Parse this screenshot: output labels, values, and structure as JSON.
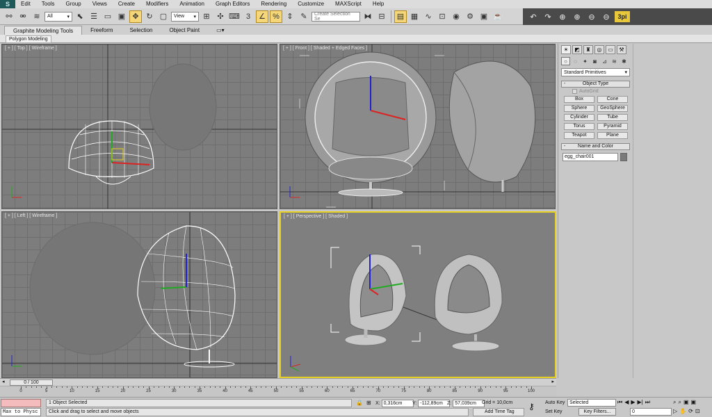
{
  "app": {
    "logo": "S"
  },
  "menu": [
    "Edit",
    "Tools",
    "Group",
    "Views",
    "Create",
    "Modifiers",
    "Animation",
    "Graph Editors",
    "Rendering",
    "Customize",
    "MAXScript",
    "Help"
  ],
  "toolbar": {
    "selection_filter": "All",
    "ref_coord": "View",
    "selection_set_placeholder": "Create Selection Se",
    "brand": "3pi"
  },
  "ribbon": {
    "tabs": [
      "Graphite Modeling Tools",
      "Freeform",
      "Selection",
      "Object Paint"
    ],
    "active_tab": 0,
    "sub_label": "Polygon Modeling"
  },
  "viewports": {
    "top": "[ + ] [ Top ] [ Wireframe ]",
    "front": "[ + ] [ Front ] [ Shaded + Edged Faces ]",
    "left": "[ + ] [ Left ] [ Wireframe ]",
    "perspective": "[ + ] [ Perspective ] [ Shaded ]"
  },
  "command_panel": {
    "dropdown": "Standard Primitives",
    "object_type_title": "Object Type",
    "autogrid": "AutoGrid",
    "primitives": [
      "Box",
      "Cone",
      "Sphere",
      "GeoSphere",
      "Cylinder",
      "Tube",
      "Torus",
      "Pyramid",
      "Teapot",
      "Plane"
    ],
    "name_color_title": "Name and Color",
    "object_name": "egg_chair001",
    "object_color": "#7a7a7a"
  },
  "timeline": {
    "frame_label": "0 / 100",
    "ticks": [
      0,
      5,
      10,
      15,
      20,
      25,
      30,
      35,
      40,
      45,
      50,
      55,
      60,
      65,
      70,
      75,
      80,
      85,
      90,
      95,
      100
    ]
  },
  "status": {
    "maxscript_out": "Max to Physc",
    "selected_text": "1 Object Selected",
    "prompt_text": "Click and drag to select and move objects",
    "x_label": "X:",
    "x_value": "0,316cm",
    "y_label": "Y:",
    "y_value": "-112,89cm",
    "z_label": "Z:",
    "z_value": "57,039cm",
    "grid": "Grid = 10,0cm",
    "add_time_tag": "Add Time Tag",
    "auto_key": "Auto Key",
    "set_key": "Set Key",
    "selected_dropdown": "Selected",
    "key_filters": "Key Filters...",
    "frame": "0"
  },
  "colors": {
    "viewport_bg": "#7d7d7d",
    "active_border": "#e8d020",
    "wire_white": "#ffffff",
    "maxscript_pink": "#f4bcbc"
  }
}
